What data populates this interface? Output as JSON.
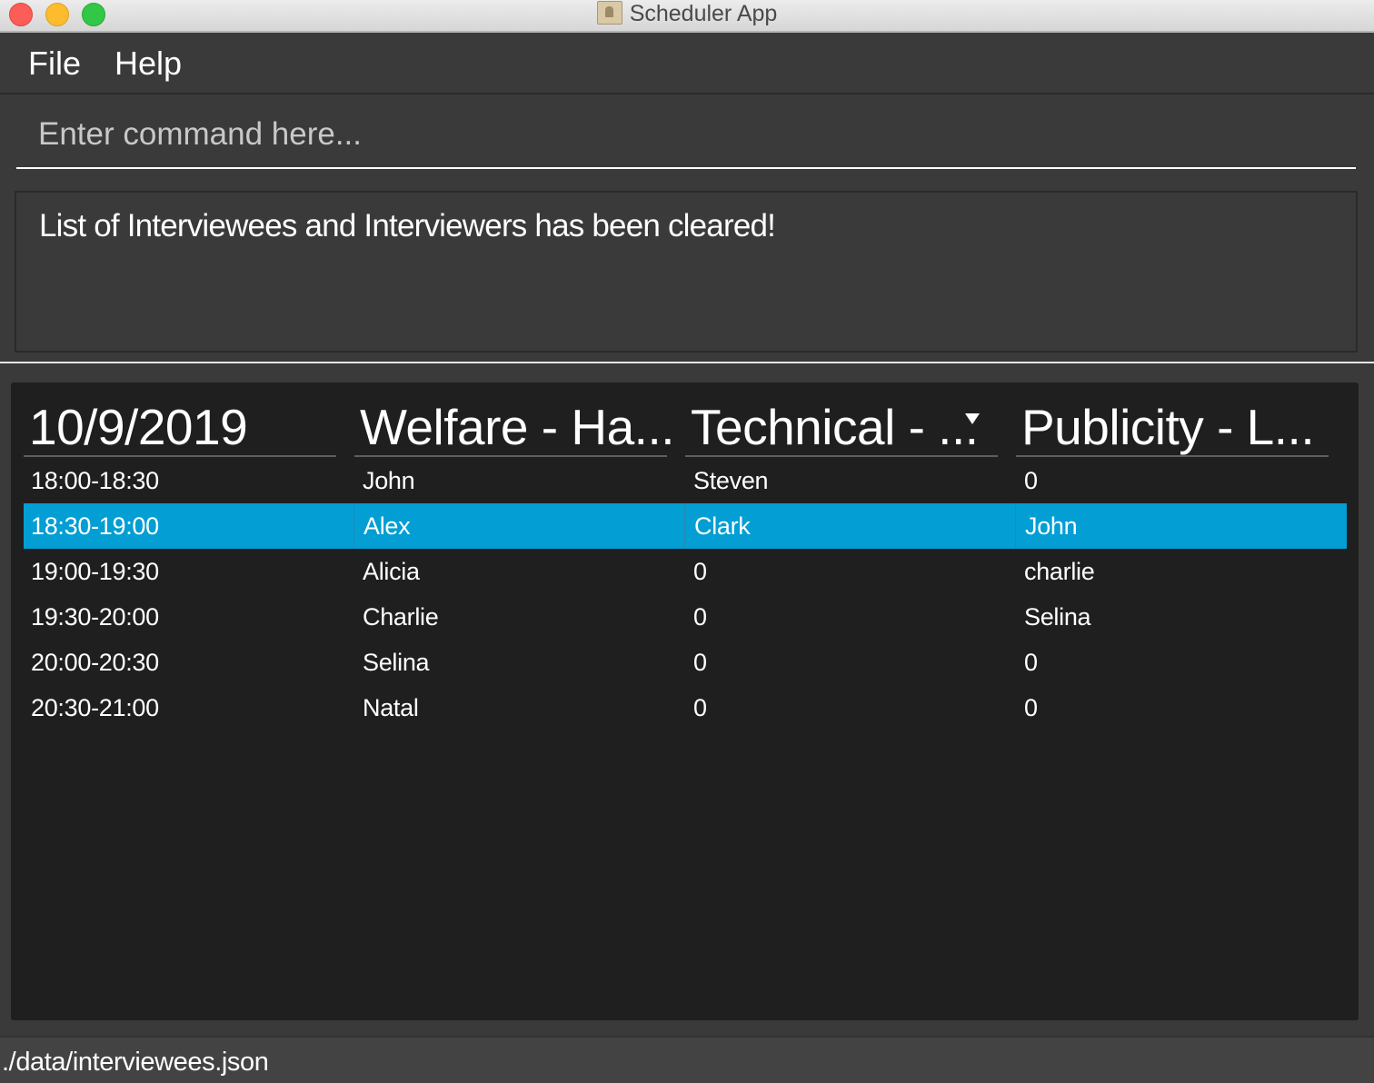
{
  "window": {
    "title": "Scheduler App"
  },
  "menu": {
    "file": "File",
    "help": "Help"
  },
  "command": {
    "placeholder": "Enter command here...",
    "value": ""
  },
  "result": {
    "message": "List of Interviewees and Interviewers has been cleared!"
  },
  "schedule": {
    "columns": [
      "10/9/2019",
      "Welfare - Ha...",
      "Technical - ...",
      "Publicity - L..."
    ],
    "sorted_column_index": 2,
    "selected_row_index": 1,
    "rows": [
      [
        "18:00-18:30",
        "John",
        "Steven",
        "0"
      ],
      [
        "18:30-19:00",
        "Alex",
        "Clark",
        "John"
      ],
      [
        "19:00-19:30",
        "Alicia",
        "0",
        "charlie"
      ],
      [
        "19:30-20:00",
        "Charlie",
        "0",
        "Selina"
      ],
      [
        "20:00-20:30",
        "Selina",
        "0",
        "0"
      ],
      [
        "20:30-21:00",
        "Natal",
        "0",
        "0"
      ]
    ]
  },
  "status": {
    "file_path": "./data/interviewees.json"
  },
  "colors": {
    "selected_row": "#039ed3",
    "table_background": "#1f1f1f",
    "window_background": "#3a3a3a"
  }
}
